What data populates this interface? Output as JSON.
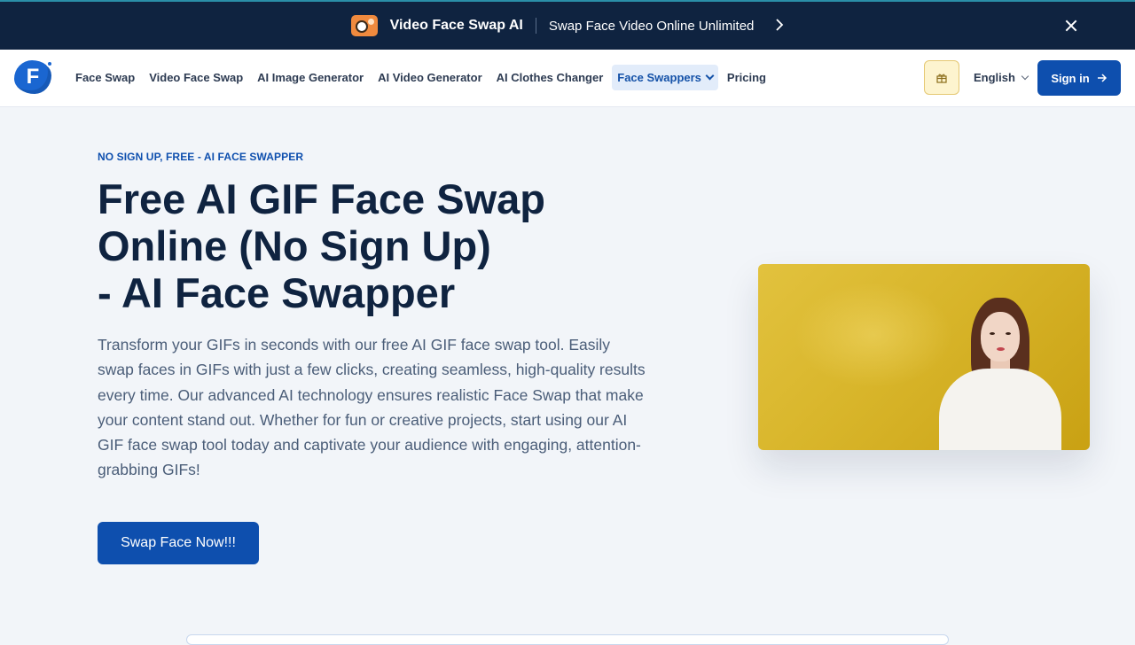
{
  "promo": {
    "title": "Video Face Swap AI",
    "subtitle": "Swap Face Video Online Unlimited"
  },
  "nav": {
    "links": [
      {
        "label": "Face Swap"
      },
      {
        "label": "Video Face Swap"
      },
      {
        "label": "AI Image Generator"
      },
      {
        "label": "AI Video Generator"
      },
      {
        "label": "AI Clothes Changer"
      },
      {
        "label": "Face Swappers"
      },
      {
        "label": "Pricing"
      }
    ],
    "language": "English",
    "signin_label": "Sign in"
  },
  "hero": {
    "eyebrow": "NO SIGN UP, FREE - AI FACE SWAPPER",
    "headline_line1": "Free AI GIF Face Swap",
    "headline_line2": "Online (No Sign Up)",
    "headline_line3": "- AI Face Swapper",
    "description": "Transform your GIFs in seconds with our free AI GIF face swap tool. Easily swap faces in GIFs with just a few clicks, creating seamless, high-quality results every time. Our advanced AI technology ensures realistic Face Swap that make your content stand out. Whether for fun or creative projects, start using our AI GIF face swap tool today and captivate your audience with engaging, attention-grabbing GIFs!",
    "cta_label": "Swap Face Now!!!"
  },
  "colors": {
    "primary": "#0e4fae",
    "promo_bg": "#0f2340",
    "page_bg": "#f2f5f9",
    "heading": "#0f2340",
    "active_nav_bg": "#e2ecfa",
    "gift_bg": "#fdf4cf"
  },
  "icons": {
    "promo_logo": "video-face-swap-logo-icon",
    "promo_arrow": "chevron-right-icon",
    "close": "close-icon",
    "brand": "faceswapper-logo-icon",
    "dropdown": "chevron-down-icon",
    "gift": "gift-icon",
    "signin_arrow": "arrow-right-icon"
  }
}
